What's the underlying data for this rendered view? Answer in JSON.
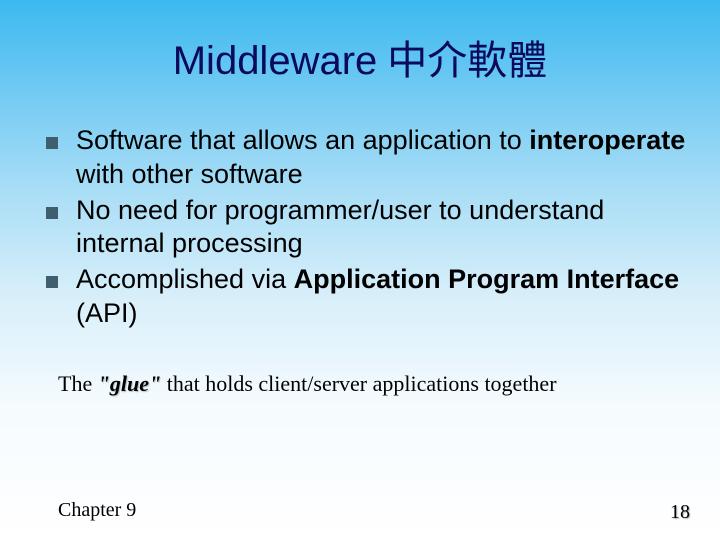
{
  "title": {
    "en": "Middleware",
    "zh": "中介軟體"
  },
  "bullets": [
    {
      "pre": "Software that allows an application to ",
      "bold": "interoperate",
      "post": " with other software"
    },
    {
      "pre": "No need for programmer/user to understand internal processing",
      "bold": "",
      "post": ""
    },
    {
      "pre": "Accomplished via ",
      "bold": "Application Program Interface",
      "post": " (API)"
    }
  ],
  "tagline": {
    "pre": "The ",
    "glue": "\"glue\"",
    "post": " that holds client/server applications together"
  },
  "footer": {
    "left": "Chapter 9",
    "right": "18"
  }
}
